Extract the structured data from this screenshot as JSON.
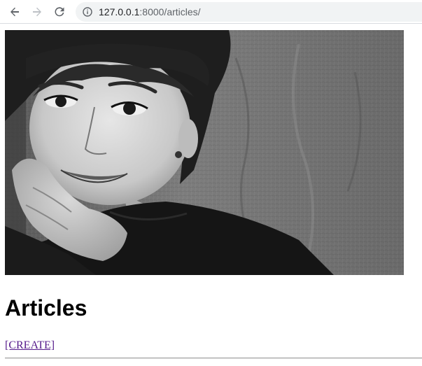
{
  "browser": {
    "back_icon": "arrow-left-icon",
    "forward_icon": "arrow-right-icon",
    "reload_icon": "reload-icon",
    "info_icon": "info-circle-icon",
    "url_host": "127.0.0.1",
    "url_rest": ":8000/articles/"
  },
  "page": {
    "photo_alt_icon": "portrait-photo",
    "heading": "Articles",
    "create_link": "[CREATE]"
  },
  "colors": {
    "link_visited": "#551a8b",
    "omnibox_bg": "#f1f3f4",
    "toolbar_icon": "#5f6368",
    "forward_disabled": "#bdc1c6"
  }
}
